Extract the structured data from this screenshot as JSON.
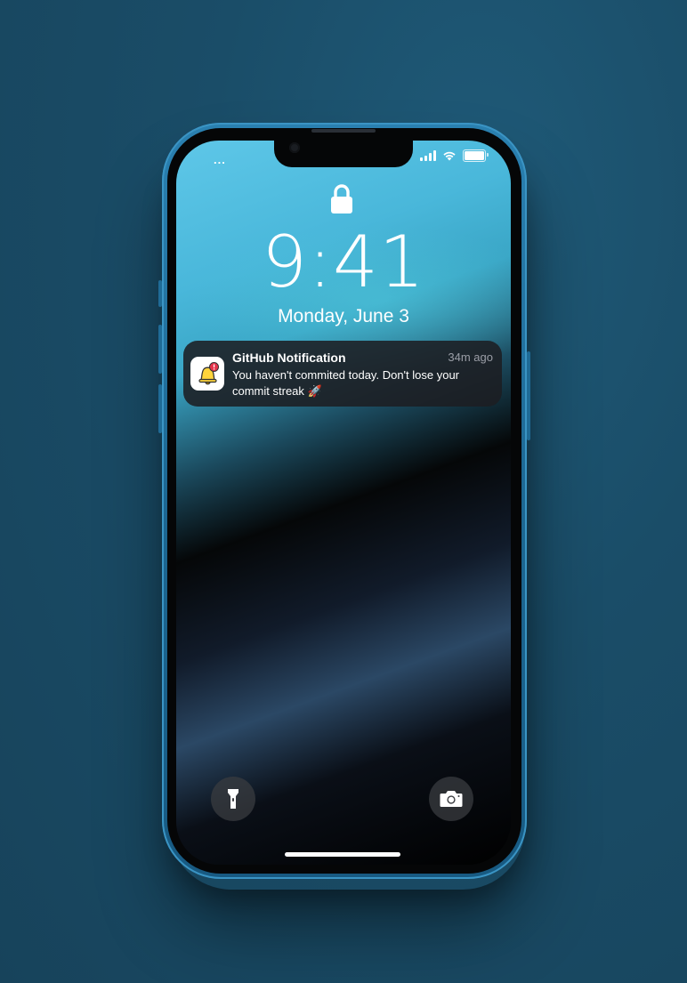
{
  "status_bar": {
    "left_text": "...",
    "icons": [
      "cellular-signal-icon",
      "wifi-icon",
      "battery-icon"
    ]
  },
  "lock_screen": {
    "lock_icon": "lock-icon",
    "time": "9:41",
    "date": "Monday, June 3"
  },
  "notification": {
    "app_icon": "bell-alert-icon",
    "title": "GitHub Notification",
    "time_ago": "34m ago",
    "body": "You haven't commited today. Don't lose your commit streak 🚀"
  },
  "bottom_controls": {
    "left": "flashlight-icon",
    "right": "camera-icon"
  },
  "colors": {
    "background": "#1a4d68",
    "phone_frame": "#1d6792",
    "notification_bg": "#1c1e22",
    "bell_yellow": "#ffd43b",
    "badge_red": "#e5334b"
  }
}
